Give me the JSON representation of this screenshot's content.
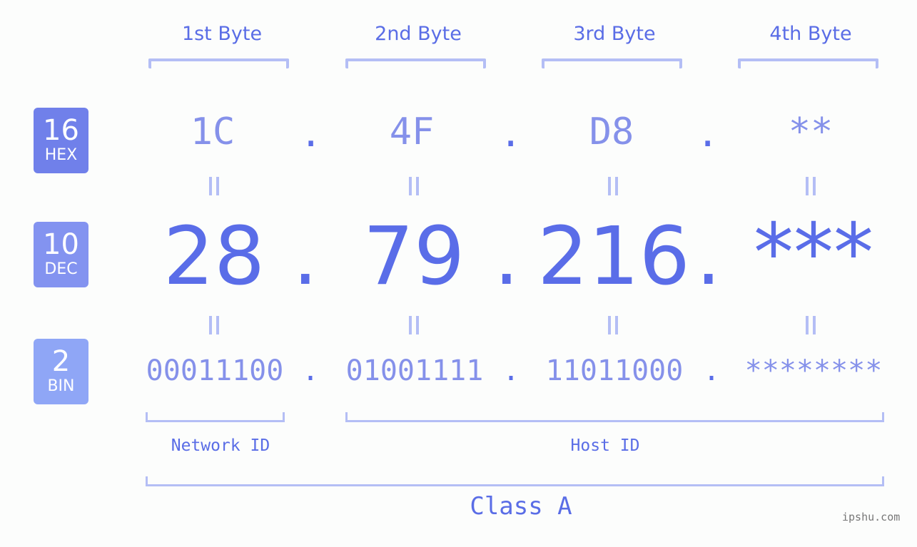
{
  "byte_headers": [
    "1st Byte",
    "2nd Byte",
    "3rd Byte",
    "4th Byte"
  ],
  "badges": [
    {
      "num": "16",
      "label": "HEX",
      "color": "#7080ea"
    },
    {
      "num": "10",
      "label": "DEC",
      "color": "#8393f0"
    },
    {
      "num": "2",
      "label": "BIN",
      "color": "#8fa6f6"
    }
  ],
  "hex": [
    "1C",
    "4F",
    "D8",
    "**"
  ],
  "dec": [
    "28",
    "79",
    "216",
    "***"
  ],
  "bin": [
    "00011100",
    "01001111",
    "11011000",
    "********"
  ],
  "separator": ".",
  "network_id_label": "Network ID",
  "host_id_label": "Host ID",
  "class_label": "Class A",
  "watermark": "ipshu.com",
  "colors": {
    "accent": "#5a6de8",
    "light": "#8591ea",
    "bracket": "#b4bef5"
  }
}
